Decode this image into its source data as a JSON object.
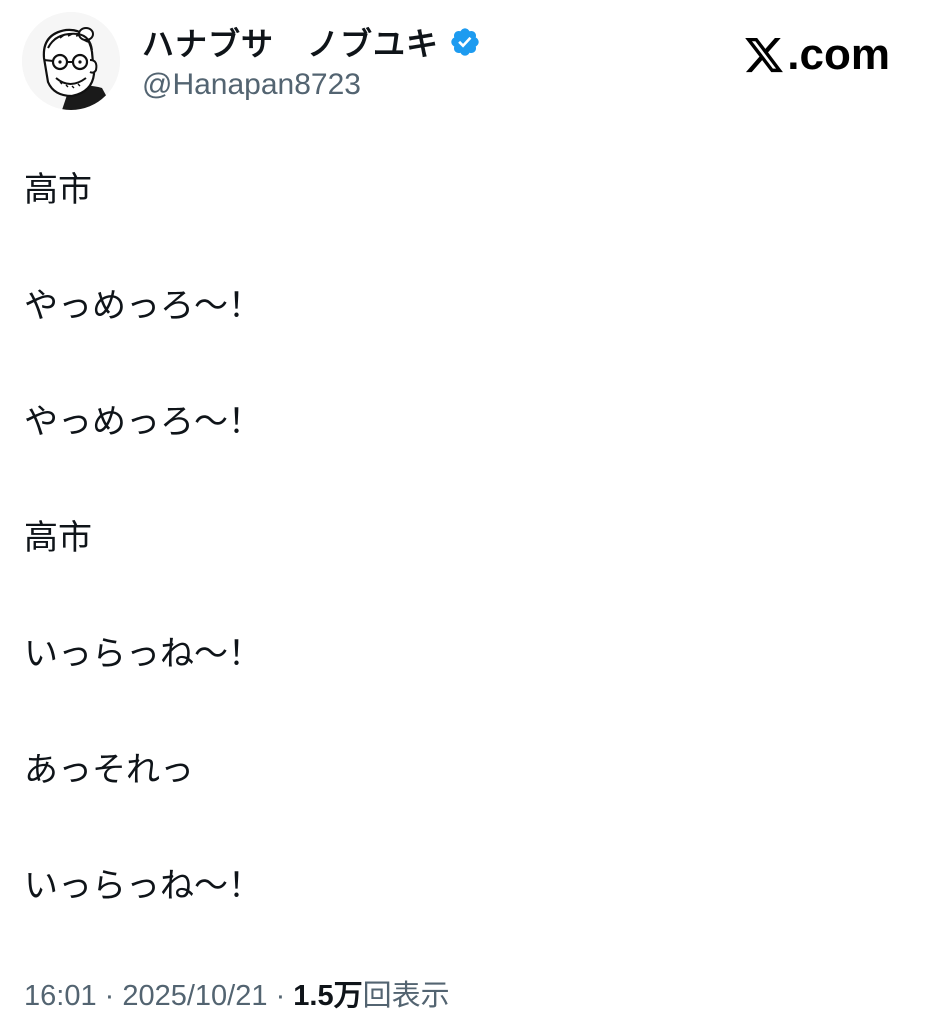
{
  "author": {
    "display_name": "ハナブサ　ノブユキ",
    "handle": "@Hanapan8723",
    "verified": true,
    "avatar_icon": "cartoon-man-glasses-avatar"
  },
  "brand": {
    "site": ".com",
    "logo_icon": "x-logo-icon"
  },
  "tweet_lines": [
    "高市",
    "やっめっろ〜！",
    "やっめっろ〜！",
    "高市",
    "いっらっね〜！",
    "あっそれっ",
    "いっらっね〜！"
  ],
  "footer": {
    "time": "16:01",
    "separator": " · ",
    "date": "2025/10/21",
    "views_count": "1.5万",
    "views_label": "回表示"
  },
  "colors": {
    "verified_blue": "#1d9bf0",
    "secondary_text": "#536471",
    "primary_text": "#0f1419"
  }
}
